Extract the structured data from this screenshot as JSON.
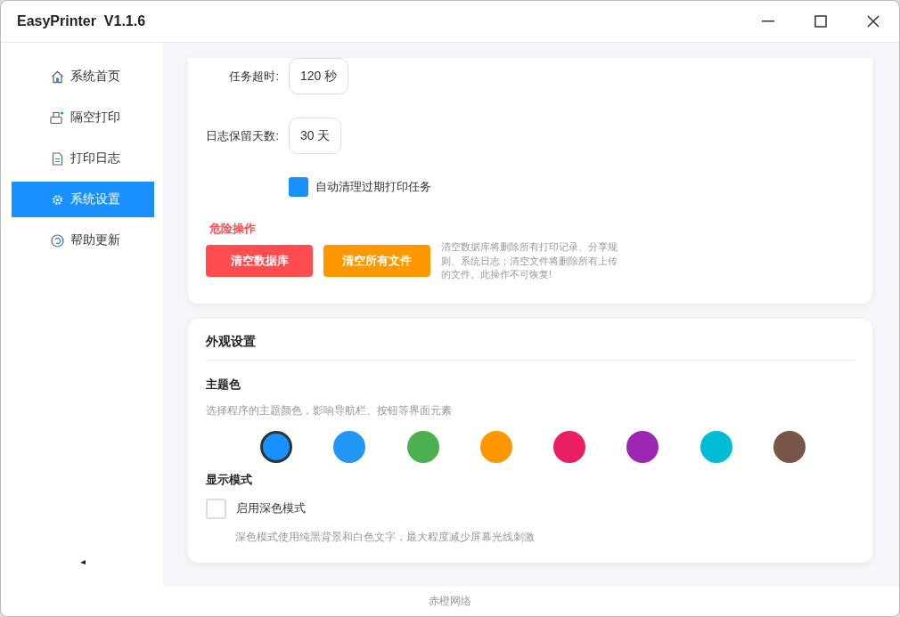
{
  "window": {
    "title": "EasyPrinter  V1.1.6"
  },
  "sidebar": {
    "items": [
      {
        "label": "系统首页",
        "selected": false
      },
      {
        "label": "隔空打印",
        "selected": false
      },
      {
        "label": "打印日志",
        "selected": false
      },
      {
        "label": "系统设置",
        "selected": true
      },
      {
        "label": "帮助更新",
        "selected": false
      }
    ]
  },
  "settings": {
    "fields": [
      {
        "label": "任务超时:",
        "value": "120 秒"
      },
      {
        "label": "日志保留天数:",
        "value": "30 天"
      }
    ],
    "auto_clean": {
      "label": "自动清理过期打印任务",
      "checked": true
    },
    "danger": {
      "title": "危险操作",
      "buttons": [
        {
          "label": "清空数据库",
          "kind": "danger"
        },
        {
          "label": "清空所有文件",
          "kind": "warning"
        }
      ],
      "note": "清空数据库将删除所有打印记录、分享规则、系统日志；清空文件将删除所有上传的文件。此操作不可恢复!"
    }
  },
  "appearance": {
    "title": "外观设置",
    "theme": {
      "title": "主题色",
      "description": "选择程序的主题颜色，影响导航栏、按钮等界面元素",
      "swatches": [
        {
          "color": "#1890ff",
          "selected": true
        },
        {
          "color": "#2196f3",
          "selected": false
        },
        {
          "color": "#4caf50",
          "selected": false
        },
        {
          "color": "#ff9800",
          "selected": false
        },
        {
          "color": "#e91e63",
          "selected": false
        },
        {
          "color": "#9c27b0",
          "selected": false
        },
        {
          "color": "#00bcd4",
          "selected": false
        },
        {
          "color": "#795548",
          "selected": false
        }
      ]
    },
    "display_mode": {
      "title": "显示模式",
      "dark_mode": {
        "label": "启用深色模式",
        "checked": false
      },
      "description": "深色模式使用纯黑背景和白色文字，最大程度减少屏幕光线刺激"
    }
  },
  "footer": {
    "text": "赤橙网络"
  }
}
